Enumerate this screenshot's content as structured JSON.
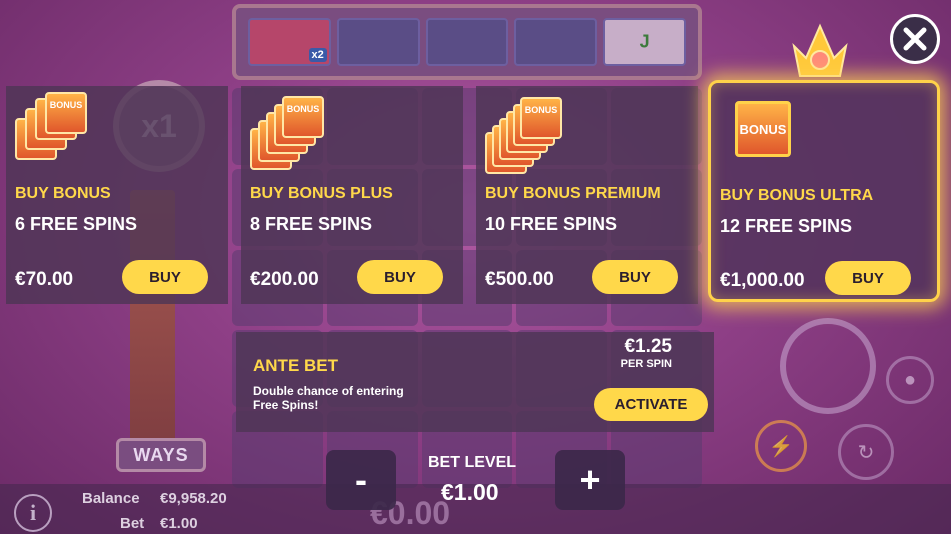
{
  "game": {
    "ways_label": "WAYS",
    "multiplier": "x1",
    "reel_top": {
      "multiplier_badge": "x2",
      "letter": "J"
    }
  },
  "buy_options": [
    {
      "title": "BUY BONUS",
      "spins": "6 FREE SPINS",
      "price": "€70.00",
      "button": "BUY",
      "card_label": "BONUS"
    },
    {
      "title": "BUY BONUS PLUS",
      "spins": "8 FREE SPINS",
      "price": "€200.00",
      "button": "BUY",
      "card_label": "BONUS"
    },
    {
      "title": "BUY BONUS PREMIUM",
      "spins": "10 FREE SPINS",
      "price": "€500.00",
      "button": "BUY",
      "card_label": "BONUS"
    },
    {
      "title": "BUY BONUS ULTRA",
      "spins": "12 FREE SPINS",
      "price": "€1,000.00",
      "button": "BUY",
      "card_label": "BONUS"
    }
  ],
  "ante_bet": {
    "title": "ANTE BET",
    "description": "Double chance of entering Free Spins!",
    "amount": "€1.25",
    "per_spin": "PER SPIN",
    "button": "ACTIVATE"
  },
  "bet_level": {
    "label": "BET LEVEL",
    "value": "€1.00",
    "minus": "-",
    "plus": "+"
  },
  "status": {
    "balance_label": "Balance",
    "balance_value": "€9,958.20",
    "bet_label": "Bet",
    "bet_value": "€1.00",
    "win_value": "€0.00"
  },
  "info_label": "i",
  "colors": {
    "accent": "#ffd84a",
    "panel_bg": "#4e3656",
    "background": "#8e3f86"
  },
  "icons": [
    "close-icon",
    "info-icon",
    "crown-icon",
    "spin-icon",
    "coins-icon",
    "turbo-icon",
    "autoplay-icon"
  ]
}
